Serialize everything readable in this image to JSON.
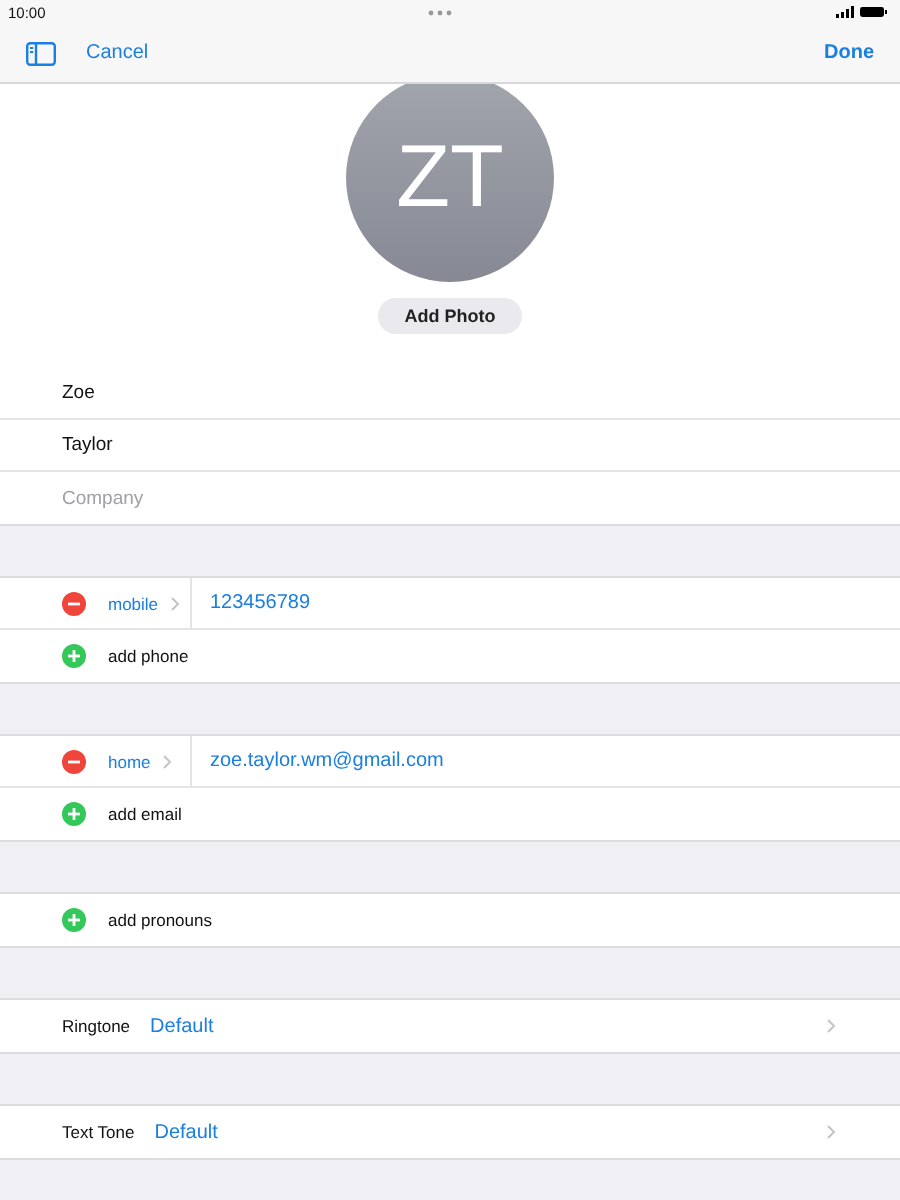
{
  "status_bar": {
    "time": "10:00"
  },
  "nav": {
    "cancel": "Cancel",
    "done": "Done"
  },
  "avatar": {
    "initials": "ZT",
    "button": "Add Photo"
  },
  "name_fields": [
    {
      "value": "Zoe"
    },
    {
      "value": "Taylor"
    },
    {
      "placeholder": "Company"
    }
  ],
  "sections": [
    {
      "rows": [
        {
          "kind": "entry",
          "label": "mobile",
          "value": "123456789"
        },
        {
          "kind": "add",
          "label": "add phone"
        }
      ]
    },
    {
      "rows": [
        {
          "kind": "entry",
          "label": "home",
          "value": "zoe.taylor.wm@gmail.com"
        },
        {
          "kind": "add",
          "label": "add email"
        }
      ]
    },
    {
      "rows": [
        {
          "kind": "add",
          "label": "add pronouns"
        }
      ]
    },
    {
      "rows": [
        {
          "kind": "setting",
          "label": "Ringtone",
          "value": "Default"
        }
      ]
    },
    {
      "rows": [
        {
          "kind": "setting",
          "label": "Text Tone",
          "value": "Default"
        }
      ]
    }
  ]
}
